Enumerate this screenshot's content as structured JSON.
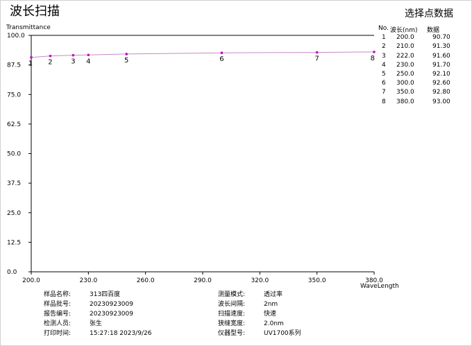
{
  "title": "波长扫描",
  "points_panel": {
    "title": "选择点数据",
    "headers": [
      "No.",
      "波长(nm)",
      "数据"
    ],
    "rows": [
      [
        "1",
        "200.0",
        "90.70"
      ],
      [
        "2",
        "210.0",
        "91.30"
      ],
      [
        "3",
        "222.0",
        "91.60"
      ],
      [
        "4",
        "230.0",
        "91.70"
      ],
      [
        "5",
        "250.0",
        "92.10"
      ],
      [
        "6",
        "300.0",
        "92.60"
      ],
      [
        "7",
        "350.0",
        "92.80"
      ],
      [
        "8",
        "380.0",
        "93.00"
      ]
    ]
  },
  "chart_data": {
    "type": "line",
    "ylabel": "Transmittance",
    "xlabel": "WaveLength",
    "xlim": [
      200,
      380
    ],
    "ylim": [
      0,
      100
    ],
    "x_ticks": [
      "200.0",
      "230.0",
      "260.0",
      "290.0",
      "320.0",
      "350.0",
      "380.0"
    ],
    "y_ticks": [
      "100.0",
      "87.5",
      "75.0",
      "62.5",
      "50.0",
      "37.5",
      "25.0",
      "12.5",
      "0.0"
    ],
    "grid": false,
    "line_color": "#c58ac5",
    "marker_color": "#cc00cc",
    "curve": {
      "x": [
        200,
        210,
        222,
        230,
        250,
        300,
        350,
        380
      ],
      "y": [
        90.7,
        91.3,
        91.6,
        91.7,
        92.1,
        92.6,
        92.8,
        93.0
      ]
    },
    "marked_points": {
      "labels": [
        "1",
        "2",
        "3",
        "4",
        "5",
        "6",
        "7",
        "8"
      ],
      "x": [
        200,
        210,
        222,
        230,
        250,
        300,
        350,
        380
      ],
      "y": [
        90.7,
        91.3,
        91.6,
        91.7,
        92.1,
        92.6,
        92.8,
        93.0
      ]
    }
  },
  "info": {
    "left": [
      {
        "label": "样品名称:",
        "value": "313四百度"
      },
      {
        "label": "样品批号:",
        "value": "20230923009"
      },
      {
        "label": "报告编号:",
        "value": "20230923009"
      },
      {
        "label": "检测人员:",
        "value": "张生"
      },
      {
        "label": "打印时间:",
        "value": "15:27:18 2023/9/26"
      }
    ],
    "right": [
      {
        "label": "测量模式:",
        "value": "透过率"
      },
      {
        "label": "波长间隔:",
        "value": "2nm"
      },
      {
        "label": "扫描速度:",
        "value": "快速"
      },
      {
        "label": "狭缝宽度:",
        "value": "2.0nm"
      },
      {
        "label": "仪器型号:",
        "value": "UV1700系列"
      }
    ]
  }
}
